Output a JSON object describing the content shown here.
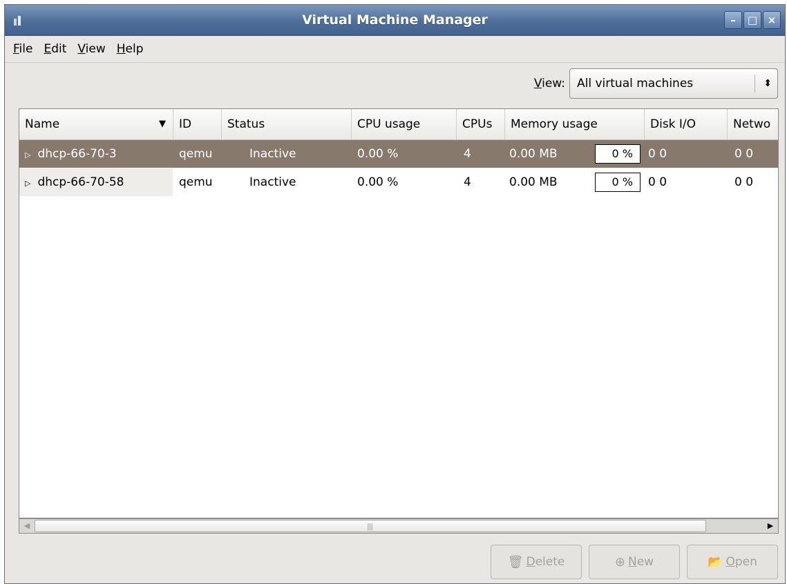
{
  "window": {
    "title": "Virtual Machine Manager"
  },
  "menu": [
    {
      "label": "File",
      "mnemonic": "F",
      "rest": "ile"
    },
    {
      "label": "Edit",
      "mnemonic": "E",
      "rest": "dit"
    },
    {
      "label": "View",
      "mnemonic": "V",
      "rest": "iew"
    },
    {
      "label": "Help",
      "mnemonic": "H",
      "rest": "elp"
    }
  ],
  "view_filter": {
    "label_mnemonic": "V",
    "label_rest": "iew:",
    "selected": "All virtual machines"
  },
  "columns": [
    "Name",
    "ID",
    "Status",
    "CPU usage",
    "CPUs",
    "Memory usage",
    "Disk I/O",
    "Netwo"
  ],
  "rows": [
    {
      "name": "dhcp-66-70-3",
      "id": "qemu",
      "status": "Inactive",
      "cpu_usage": "0.00 %",
      "cpus": "4",
      "memory": "0.00 MB",
      "memory_percent": "0 %",
      "disk_io": "0 0",
      "network": "0 0",
      "selected": true
    },
    {
      "name": "dhcp-66-70-58",
      "id": "qemu",
      "status": "Inactive",
      "cpu_usage": "0.00 %",
      "cpus": "4",
      "memory": "0.00 MB",
      "memory_percent": "0 %",
      "disk_io": "0 0",
      "network": "0 0",
      "selected": false
    }
  ],
  "buttons": {
    "delete": {
      "mnemonic": "D",
      "rest": "elete",
      "icon": "trash-icon"
    },
    "new": {
      "mnemonic": "N",
      "rest": "ew",
      "icon": "new-vm-icon"
    },
    "open": {
      "mnemonic": "O",
      "rest": "pen",
      "icon": "folder-open-icon"
    }
  },
  "colors": {
    "selected_row": "#877a6c",
    "titlebar": "#4f6f9b",
    "window_bg": "#e8e7e3"
  }
}
